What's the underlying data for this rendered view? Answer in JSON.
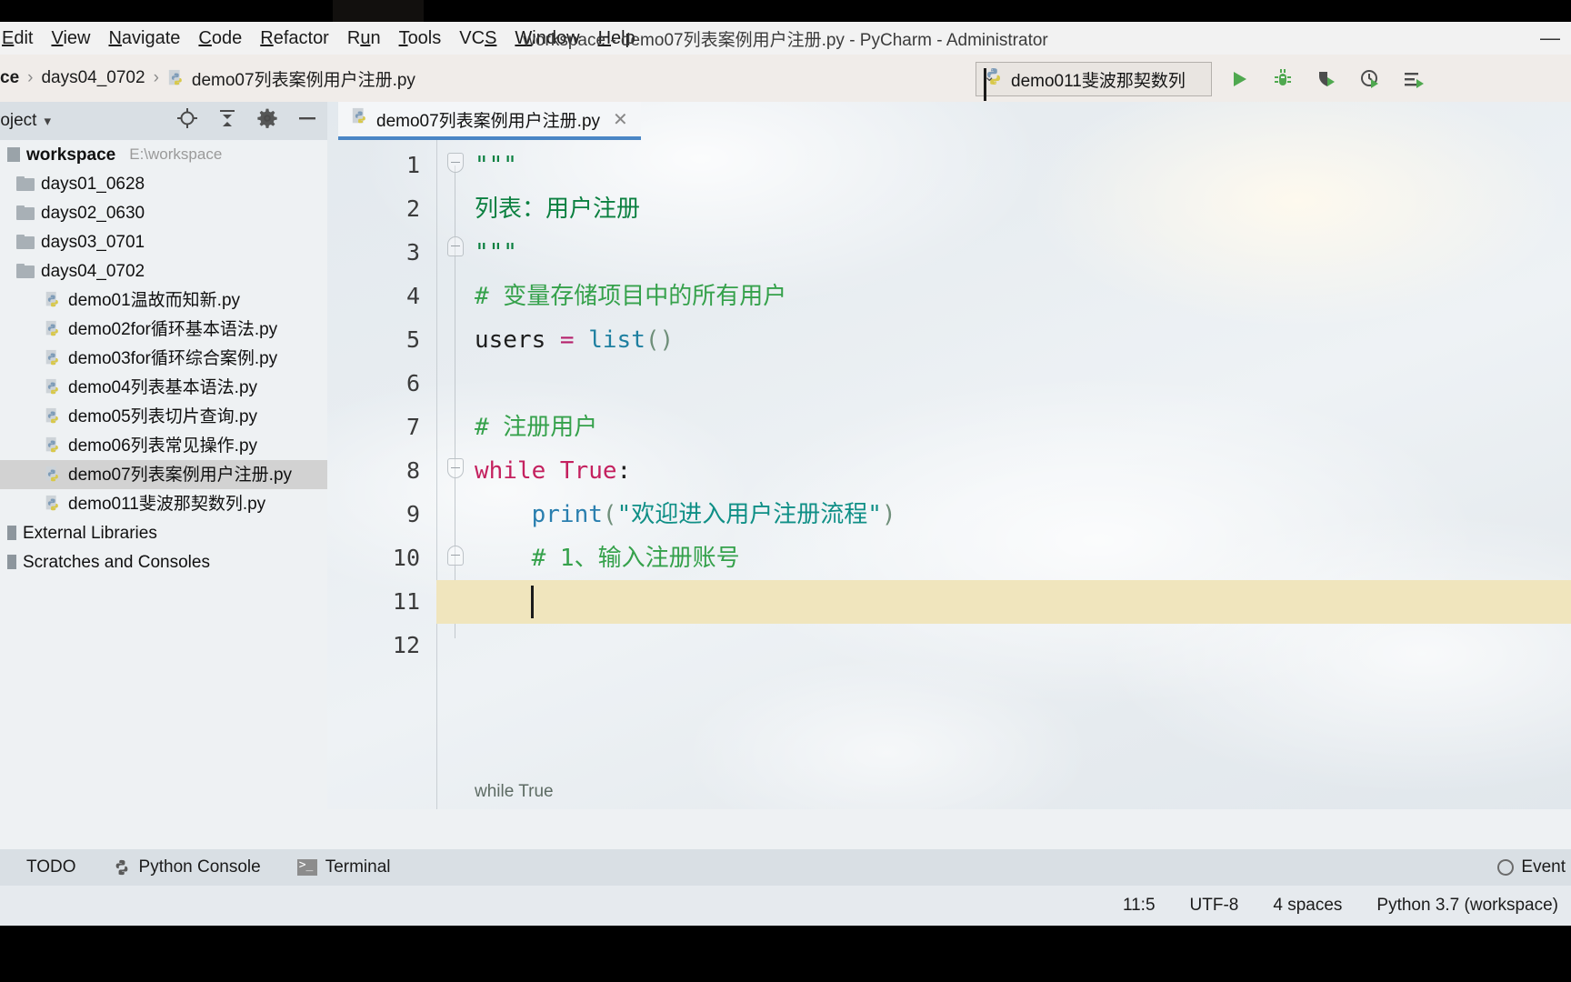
{
  "window": {
    "title": "workspace - demo07列表案例用户注册.py - PyCharm - Administrator",
    "minimize_glyph": "—"
  },
  "menubar": {
    "items": [
      {
        "label": "Edit",
        "mnemonic": "E"
      },
      {
        "label": "View",
        "mnemonic": "V"
      },
      {
        "label": "Navigate",
        "mnemonic": "N"
      },
      {
        "label": "Code",
        "mnemonic": "C"
      },
      {
        "label": "Refactor",
        "mnemonic": "R"
      },
      {
        "label": "Run",
        "mnemonic": "u"
      },
      {
        "label": "Tools",
        "mnemonic": "T"
      },
      {
        "label": "VCS",
        "mnemonic": "S"
      },
      {
        "label": "Window",
        "mnemonic": "W"
      },
      {
        "label": "Help",
        "mnemonic": "H"
      }
    ]
  },
  "navbar": {
    "crumbs": [
      "ce",
      "days04_0702",
      "demo07列表案例用户注册.py"
    ],
    "separator": "›"
  },
  "run_config": {
    "name": "demo011斐波那契数列",
    "caret": "⌄",
    "icons": [
      {
        "name": "run-icon",
        "glyph": "▶"
      },
      {
        "name": "debug-icon",
        "glyph": "bug"
      },
      {
        "name": "run-with-coverage-icon",
        "glyph": "shield"
      },
      {
        "name": "profile-icon",
        "glyph": "clock"
      },
      {
        "name": "run-anything-icon",
        "glyph": "lines"
      }
    ]
  },
  "project_panel": {
    "title": "roject",
    "dropdown_caret": "▾",
    "header_icons": [
      {
        "name": "locate-icon"
      },
      {
        "name": "collapse-all-icon"
      },
      {
        "name": "settings-gear-icon"
      },
      {
        "name": "hide-icon"
      }
    ],
    "tree": [
      {
        "label": "workspace",
        "path": "E:\\workspace",
        "type": "project",
        "indent": 0,
        "selected": false
      },
      {
        "label": "days01_0628",
        "type": "folder",
        "indent": 1,
        "selected": false
      },
      {
        "label": "days02_0630",
        "type": "folder",
        "indent": 1,
        "selected": false
      },
      {
        "label": "days03_0701",
        "type": "folder",
        "indent": 1,
        "selected": false
      },
      {
        "label": "days04_0702",
        "type": "folder",
        "indent": 1,
        "selected": false
      },
      {
        "label": "demo01温故而知新.py",
        "type": "python",
        "indent": 2,
        "selected": false
      },
      {
        "label": "demo02for循环基本语法.py",
        "type": "python",
        "indent": 2,
        "selected": false
      },
      {
        "label": "demo03for循环综合案例.py",
        "type": "python",
        "indent": 2,
        "selected": false
      },
      {
        "label": "demo04列表基本语法.py",
        "type": "python",
        "indent": 2,
        "selected": false
      },
      {
        "label": "demo05列表切片查询.py",
        "type": "python",
        "indent": 2,
        "selected": false
      },
      {
        "label": "demo06列表常见操作.py",
        "type": "python",
        "indent": 2,
        "selected": false
      },
      {
        "label": "demo07列表案例用户注册.py",
        "type": "python",
        "indent": 2,
        "selected": true
      },
      {
        "label": "demo011斐波那契数列.py",
        "type": "python",
        "indent": 2,
        "selected": false
      },
      {
        "label": "External Libraries",
        "type": "lib",
        "indent": 0,
        "selected": false
      },
      {
        "label": "Scratches and Consoles",
        "type": "lib",
        "indent": 0,
        "selected": false
      }
    ]
  },
  "editor": {
    "tab": {
      "label": "demo07列表案例用户注册.py",
      "close_glyph": "✕"
    },
    "current_line": 11,
    "breadcrumb": "while True",
    "line_numbers": [
      "1",
      "2",
      "3",
      "4",
      "5",
      "6",
      "7",
      "8",
      "9",
      "10",
      "11",
      "12"
    ],
    "lines": [
      {
        "n": 1,
        "tokens": [
          {
            "t": "\"\"\"",
            "c": "s-doc"
          }
        ]
      },
      {
        "n": 2,
        "tokens": [
          {
            "t": "列表：用户注册",
            "c": "s-doc"
          }
        ]
      },
      {
        "n": 3,
        "tokens": [
          {
            "t": "\"\"\"",
            "c": "s-doc"
          }
        ]
      },
      {
        "n": 4,
        "tokens": [
          {
            "t": "# 变量存储项目中的所有用户",
            "c": "s-cmt"
          }
        ]
      },
      {
        "n": 5,
        "tokens": [
          {
            "t": "users ",
            "c": "s-txt"
          },
          {
            "t": "= ",
            "c": "s-op"
          },
          {
            "t": "list",
            "c": "s-bi"
          },
          {
            "t": "()",
            "c": "s-paren"
          }
        ]
      },
      {
        "n": 6,
        "tokens": []
      },
      {
        "n": 7,
        "tokens": [
          {
            "t": "# 注册用户",
            "c": "s-cmt"
          }
        ]
      },
      {
        "n": 8,
        "tokens": [
          {
            "t": "while True",
            "c": "s-kw"
          },
          {
            "t": ":",
            "c": "s-txt"
          }
        ]
      },
      {
        "n": 9,
        "tokens": [
          {
            "t": "    ",
            "c": "s-txt"
          },
          {
            "t": "print",
            "c": "s-fn"
          },
          {
            "t": "(",
            "c": "s-paren"
          },
          {
            "t": "\"欢迎进入用户注册流程\"",
            "c": "s-str"
          },
          {
            "t": ")",
            "c": "s-paren"
          }
        ]
      },
      {
        "n": 10,
        "tokens": [
          {
            "t": "    # 1、输入注册账号",
            "c": "s-cmt"
          }
        ]
      },
      {
        "n": 11,
        "tokens": [
          {
            "t": "    ",
            "c": "s-txt"
          }
        ]
      },
      {
        "n": 12,
        "tokens": []
      }
    ]
  },
  "tool_windows": {
    "items": [
      {
        "label": "TODO",
        "icon": "todo-icon"
      },
      {
        "label": "Python Console",
        "icon": "python-icon"
      },
      {
        "label": "Terminal",
        "icon": "terminal-icon"
      }
    ],
    "event_log": "Event"
  },
  "statusbar": {
    "position": "11:5",
    "encoding": "UTF-8",
    "indent": "4 spaces",
    "interpreter": "Python 3.7 (workspace)"
  },
  "colors": {
    "accent_tab": "#4a86c5",
    "current_line": "#f0e5bd",
    "selection": "#d2d2d2",
    "comment": "#35a14b",
    "keyword": "#c4215f",
    "string": "#0f8f86",
    "function": "#2a7faf"
  }
}
